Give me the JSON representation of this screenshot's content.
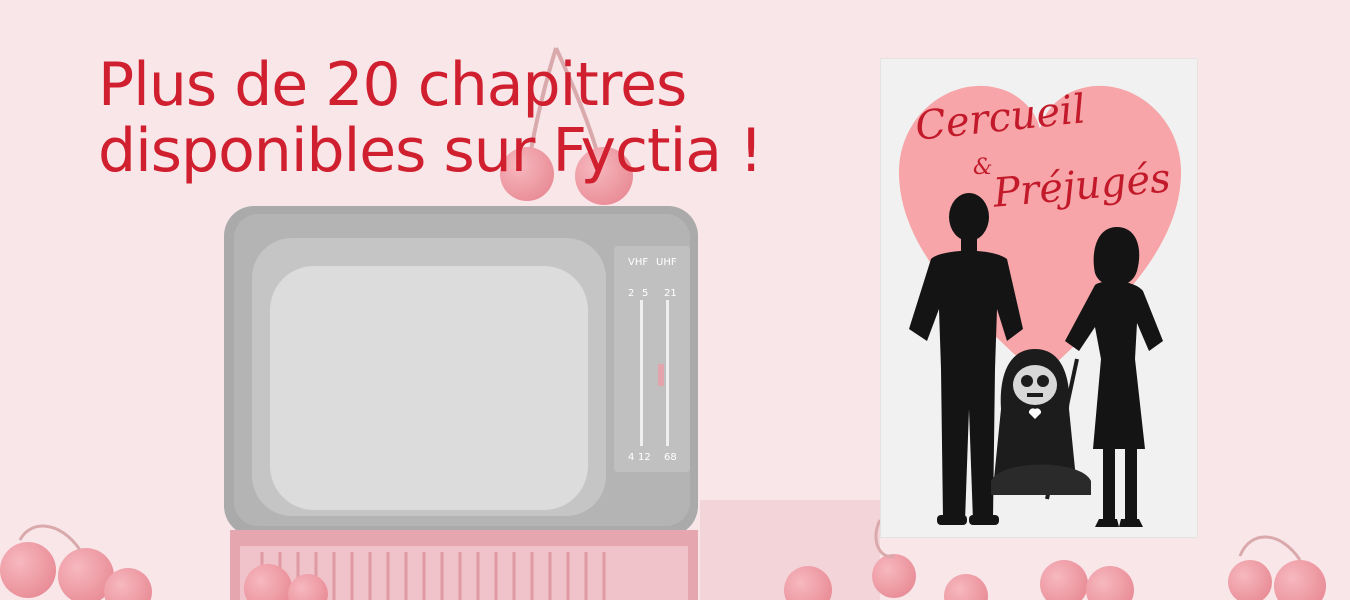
{
  "headline": {
    "line1": "Plus de 20 chapitres",
    "line2": "disponibles sur Fyctia !"
  },
  "cover": {
    "title_line1": "Cercueil",
    "title_amp": "&",
    "title_line2": "Préjugés"
  },
  "tv_dial": {
    "vhf_label": "VHF",
    "uhf_label": "UHF",
    "num_a": "2",
    "num_b": "5",
    "num_c": "21",
    "num_d": "4",
    "num_e": "12",
    "num_f": "68"
  },
  "colors": {
    "headline": "#d01f2e",
    "background": "#f8e6e9",
    "heart": "#f7a5a8"
  },
  "icons": [
    "cherry-icon",
    "heart-icon",
    "tv-illustration",
    "reaper-illustration"
  ]
}
